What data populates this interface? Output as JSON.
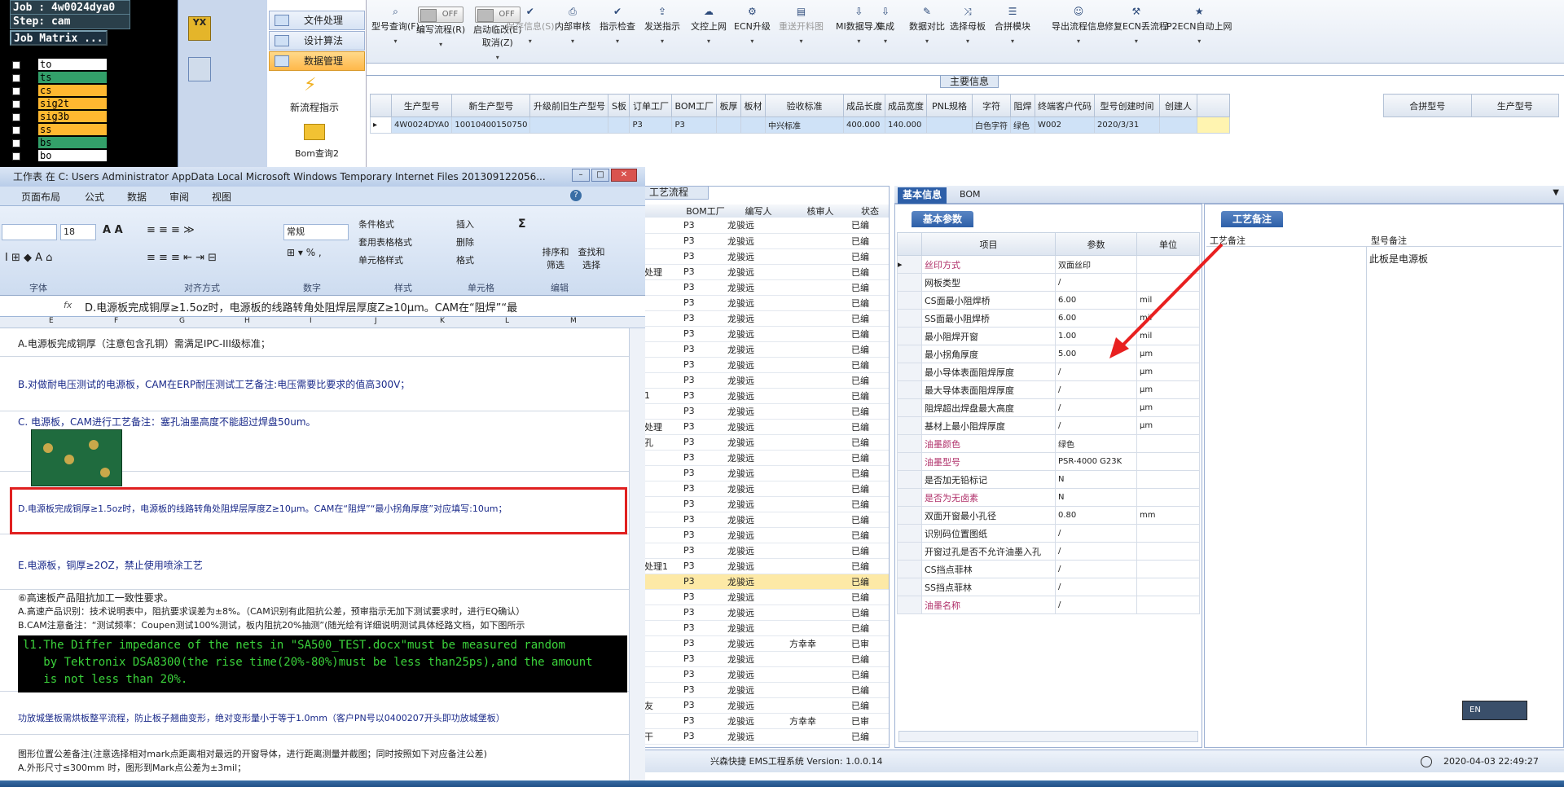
{
  "job_pane": {
    "job": "Job : 4w0024dya0",
    "step": "Step: cam",
    "matrix_button": "Job Matrix ...",
    "layers": [
      {
        "name": "to",
        "color": "#ffffff"
      },
      {
        "name": "ts",
        "color": "#33a06a"
      },
      {
        "name": "cs",
        "color": "#ffb830"
      },
      {
        "name": "sig2t",
        "color": "#ffb830"
      },
      {
        "name": "sig3b",
        "color": "#ffb830"
      },
      {
        "name": "ss",
        "color": "#ffb830"
      },
      {
        "name": "bs",
        "color": "#33a06a"
      },
      {
        "name": "bo",
        "color": "#ffffff"
      }
    ]
  },
  "nav": {
    "items": [
      "文件处理",
      "设计算法",
      "数据管理"
    ],
    "new_process": "新流程指示",
    "bom_query": "Bom查询2"
  },
  "toolbar": {
    "items": [
      {
        "label": "型号查询(F)",
        "icon": "search-icon"
      },
      {
        "label": "编写流程(R)",
        "icon": "toggle",
        "toggle": "OFF"
      },
      {
        "label": "启动临改(E)",
        "label2": "取消(Z)",
        "icon": "toggle",
        "toggle": "OFF"
      },
      {
        "label": "保存信息(S)",
        "icon": "check-icon",
        "disabled": true
      },
      {
        "label": "内部审核",
        "icon": "print-icon"
      },
      {
        "label": "指示检查",
        "icon": "check-icon"
      },
      {
        "label": "发送指示",
        "icon": "upload-icon"
      },
      {
        "label": "文控上网",
        "icon": "cloud-icon"
      },
      {
        "label": "ECN升级",
        "icon": "gear-icon"
      },
      {
        "label": "重送开料图",
        "icon": "doc-icon",
        "disabled": true
      },
      {
        "label": "MI数据导入",
        "icon": "import-icon"
      },
      {
        "label": "集成",
        "icon": "download-icon"
      },
      {
        "label": "数据对比",
        "icon": "tools-icon"
      },
      {
        "label": "选择母板",
        "icon": "shuffle-icon"
      },
      {
        "label": "合拼模块",
        "icon": "list-icon"
      },
      {
        "label": "导出流程信息",
        "icon": "smile-icon"
      },
      {
        "label": "修复ECN丢流程",
        "icon": "wrench-icon"
      },
      {
        "label": "P2ECN自动上网",
        "icon": "star-icon"
      }
    ]
  },
  "main_info": {
    "title": "主要信息",
    "columns": [
      "生产型号",
      "新生产型号",
      "升级前旧生产型号",
      "S板",
      "订单工厂",
      "BOM工厂",
      "板厚",
      "板材",
      "验收标准",
      "成品长度",
      "成品宽度",
      "PNL规格",
      "字符",
      "阻焊",
      "终端客户代码",
      "型号创建时间",
      "创建人"
    ],
    "row": [
      "4W0024DYA0",
      "10010400150750",
      "",
      "",
      "P3",
      "P3",
      "",
      "",
      "中兴标准",
      "400.000",
      "140.000",
      "",
      "白色字符",
      "绿色",
      "W002",
      "2020/3/31",
      ""
    ],
    "side_columns": [
      "合拼型号",
      "生产型号"
    ]
  },
  "process": {
    "tab": "工艺流程",
    "columns": [
      "BOM工厂",
      "编写人",
      "核审人",
      "状态"
    ],
    "rows": [
      {
        "pre": "",
        "bom": "P3",
        "writer": "龙骏远",
        "reviewer": "",
        "status": "已编"
      },
      {
        "pre": "",
        "bom": "P3",
        "writer": "龙骏远",
        "reviewer": "",
        "status": "已编"
      },
      {
        "pre": "",
        "bom": "P3",
        "writer": "龙骏远",
        "reviewer": "",
        "status": "已编"
      },
      {
        "pre": "处理",
        "bom": "P3",
        "writer": "龙骏远",
        "reviewer": "",
        "status": "已编"
      },
      {
        "pre": "",
        "bom": "P3",
        "writer": "龙骏远",
        "reviewer": "",
        "status": "已编"
      },
      {
        "pre": "",
        "bom": "P3",
        "writer": "龙骏远",
        "reviewer": "",
        "status": "已编"
      },
      {
        "pre": "",
        "bom": "P3",
        "writer": "龙骏远",
        "reviewer": "",
        "status": "已编"
      },
      {
        "pre": "",
        "bom": "P3",
        "writer": "龙骏远",
        "reviewer": "",
        "status": "已编"
      },
      {
        "pre": "",
        "bom": "P3",
        "writer": "龙骏远",
        "reviewer": "",
        "status": "已编"
      },
      {
        "pre": "",
        "bom": "P3",
        "writer": "龙骏远",
        "reviewer": "",
        "status": "已编"
      },
      {
        "pre": "",
        "bom": "P3",
        "writer": "龙骏远",
        "reviewer": "",
        "status": "已编"
      },
      {
        "pre": "1",
        "bom": "P3",
        "writer": "龙骏远",
        "reviewer": "",
        "status": "已编"
      },
      {
        "pre": "",
        "bom": "P3",
        "writer": "龙骏远",
        "reviewer": "",
        "status": "已编"
      },
      {
        "pre": "处理",
        "bom": "P3",
        "writer": "龙骏远",
        "reviewer": "",
        "status": "已编"
      },
      {
        "pre": "孔",
        "bom": "P3",
        "writer": "龙骏远",
        "reviewer": "",
        "status": "已编"
      },
      {
        "pre": "",
        "bom": "P3",
        "writer": "龙骏远",
        "reviewer": "",
        "status": "已编"
      },
      {
        "pre": "",
        "bom": "P3",
        "writer": "龙骏远",
        "reviewer": "",
        "status": "已编"
      },
      {
        "pre": "",
        "bom": "P3",
        "writer": "龙骏远",
        "reviewer": "",
        "status": "已编"
      },
      {
        "pre": "",
        "bom": "P3",
        "writer": "龙骏远",
        "reviewer": "",
        "status": "已编"
      },
      {
        "pre": "",
        "bom": "P3",
        "writer": "龙骏远",
        "reviewer": "",
        "status": "已编"
      },
      {
        "pre": "",
        "bom": "P3",
        "writer": "龙骏远",
        "reviewer": "",
        "status": "已编"
      },
      {
        "pre": "",
        "bom": "P3",
        "writer": "龙骏远",
        "reviewer": "",
        "status": "已编"
      },
      {
        "pre": "处理1",
        "bom": "P3",
        "writer": "龙骏远",
        "reviewer": "",
        "status": "已编"
      },
      {
        "pre": "",
        "bom": "P3",
        "writer": "龙骏远",
        "reviewer": "",
        "status": "已编",
        "hl": true
      },
      {
        "pre": "",
        "bom": "P3",
        "writer": "龙骏远",
        "reviewer": "",
        "status": "已编"
      },
      {
        "pre": "",
        "bom": "P3",
        "writer": "龙骏远",
        "reviewer": "",
        "status": "已编"
      },
      {
        "pre": "",
        "bom": "P3",
        "writer": "龙骏远",
        "reviewer": "",
        "status": "已编"
      },
      {
        "pre": "",
        "bom": "P3",
        "writer": "龙骏远",
        "reviewer": "方幸幸",
        "status": "已审"
      },
      {
        "pre": "",
        "bom": "P3",
        "writer": "龙骏远",
        "reviewer": "",
        "status": "已编"
      },
      {
        "pre": "",
        "bom": "P3",
        "writer": "龙骏远",
        "reviewer": "",
        "status": "已编"
      },
      {
        "pre": "",
        "bom": "P3",
        "writer": "龙骏远",
        "reviewer": "",
        "status": "已编"
      },
      {
        "pre": "友",
        "bom": "P3",
        "writer": "龙骏远",
        "reviewer": "",
        "status": "已编"
      },
      {
        "pre": "",
        "bom": "P3",
        "writer": "龙骏远",
        "reviewer": "方幸幸",
        "status": "已审"
      },
      {
        "pre": "干",
        "bom": "P3",
        "writer": "龙骏远",
        "reviewer": "",
        "status": "已编"
      }
    ]
  },
  "basic": {
    "tab_basic": "基本信息",
    "tab_bom": "BOM",
    "sub_tab": "基本参数",
    "columns": [
      "项目",
      "参数",
      "单位"
    ],
    "rows": [
      {
        "k": "丝印方式",
        "v": "双面丝印",
        "u": "",
        "pink": true
      },
      {
        "k": "网板类型",
        "v": "/",
        "u": ""
      },
      {
        "k": "CS面最小阻焊桥",
        "v": "6.00",
        "u": "mil"
      },
      {
        "k": "SS面最小阻焊桥",
        "v": "6.00",
        "u": "mil"
      },
      {
        "k": "最小阻焊开窗",
        "v": "1.00",
        "u": "mil"
      },
      {
        "k": "最小拐角厚度",
        "v": "5.00",
        "u": "μm"
      },
      {
        "k": "最小导体表面阻焊厚度",
        "v": "/",
        "u": "μm"
      },
      {
        "k": "最大导体表面阻焊厚度",
        "v": "/",
        "u": "μm"
      },
      {
        "k": "阻焊超出焊盘最大高度",
        "v": "/",
        "u": "μm"
      },
      {
        "k": "基材上最小阻焊厚度",
        "v": "/",
        "u": "μm"
      },
      {
        "k": "油墨颜色",
        "v": "绿色",
        "u": "",
        "pink": true
      },
      {
        "k": "油墨型号",
        "v": "PSR-4000 G23K",
        "u": "",
        "pink": true
      },
      {
        "k": "是否加无铅标记",
        "v": "N",
        "u": ""
      },
      {
        "k": "是否为无卤素",
        "v": "N",
        "u": "",
        "pink": true
      },
      {
        "k": "双面开窗最小孔径",
        "v": "0.80",
        "u": "mm"
      },
      {
        "k": "识别码位置图纸",
        "v": "/",
        "u": ""
      },
      {
        "k": "开窗过孔是否不允许油墨入孔",
        "v": "/",
        "u": ""
      },
      {
        "k": "CS挡点菲林",
        "v": "/",
        "u": ""
      },
      {
        "k": "SS挡点菲林",
        "v": "/",
        "u": ""
      },
      {
        "k": "油墨名称",
        "v": "/",
        "u": "",
        "pink": true
      }
    ]
  },
  "remark": {
    "tab": "工艺备注",
    "col1": "工艺备注",
    "col2": "型号备注",
    "value": "此板是电源板"
  },
  "excel": {
    "title": "工作表 在 C: Users Administrator AppData Local Microsoft Windows Temporary Internet Files 201309122056...",
    "tabs": [
      "页面布局",
      "公式",
      "数据",
      "审阅",
      "视图"
    ],
    "font_size": "18",
    "number_format": "常规",
    "groups": [
      "字体",
      "对齐方式",
      "数字",
      "样式",
      "单元格",
      "编辑"
    ],
    "style_items": [
      "条件格式",
      "套用表格格式",
      "单元格样式"
    ],
    "cell_items": [
      "插入",
      "删除",
      "格式"
    ],
    "edit_items": [
      "排序和筛选",
      "查找和选择"
    ],
    "formula": "D.电源板完成铜厚≥1.5oz时，电源板的线路转角处阻焊层厚度Z≥10μm。CAM在“阻焊”“最",
    "columns": [
      "E",
      "F",
      "G",
      "H",
      "I",
      "J",
      "K",
      "L",
      "M"
    ],
    "lines": {
      "a": "A.电源板完成铜厚（注意包含孔铜）需满足IPC-III级标准；",
      "b": "B.对做耐电压测试的电源板，CAM在ERP耐压测试工艺备注:电压需要比要求的值高300V；",
      "c": "C. 电源板，CAM进行工艺备注：塞孔油墨高度不能超过焊盘50um。",
      "d": "D.电源板完成铜厚≥1.5oz时，电源板的线路转角处阻焊层厚度Z≥10μm。CAM在“阻焊”“最小拐角厚度”对应填写:10um；",
      "e": "E.电源板，铜厚≥2OZ，禁止使用喷涂工艺",
      "f1": "⑥高速板产品阻抗加工一致性要求。",
      "f2": "A.高速产品识别：技术说明表中，阻抗要求误差为±8%。（CAM识别有此阻抗公差，预审指示无加下测试要求时，进行EQ确认）",
      "f3": "B.CAM注意备注：“测试频率：Coupen测试100%测试，板内阻抗20%抽测”(随光绘有详细说明测试具体经路文档，如下图所示",
      "console": "l1.The Differ impedance of the nets in \"SA500_TEST.docx\"must be measured random\n   by Tektronix DSA8300(the rise time(20%-80%)must be less than25ps),and the amount\n   is not less than 20%.",
      "g": "功放城堡板需烘板整平流程，防止板子翘曲变形，绝对变形量小于等于1.0mm（客户PN号以0400207开头即功放城堡板）",
      "h1": "图形位置公差备注(注意选择相对mark点距离相对最远的开窗导体，进行距离测量并截图；同时按照如下对应备注公差)",
      "h2": "A.外形尺寸≤300mm 时，图形到Mark点公差为±3mil；"
    }
  },
  "status": {
    "system": "兴森快捷 EMS工程系统 Version: 1.0.0.14",
    "datetime": "2020-04-03 22:49:27"
  },
  "ime": "EN"
}
